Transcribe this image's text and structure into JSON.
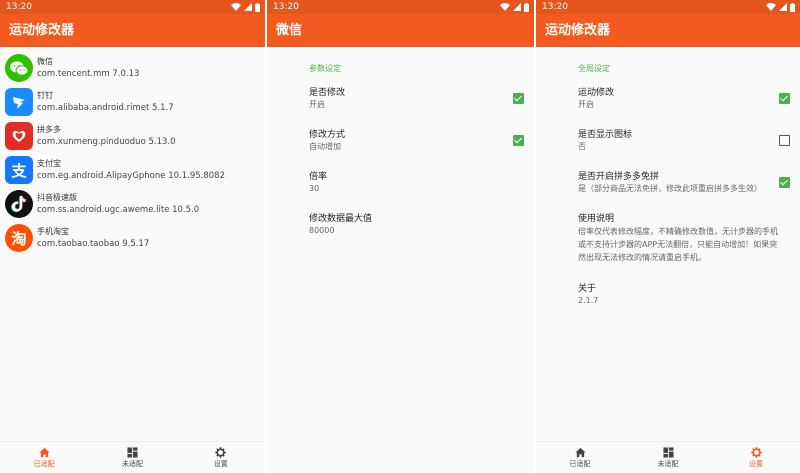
{
  "status": {
    "time": "13:20"
  },
  "colors": {
    "accent": "#f25a20",
    "status_bar": "#e4561e",
    "checkbox_on": "#4caf50"
  },
  "apps_screen": {
    "title": "运动修改器",
    "apps": [
      {
        "name": "微信",
        "package": "com.tencent.mm 7.0.13",
        "icon": "wechat-icon"
      },
      {
        "name": "钉钉",
        "package": "com.alibaba.android.rimet 5.1.7",
        "icon": "dingtalk-icon"
      },
      {
        "name": "拼多多",
        "package": "com.xunmeng.pinduoduo 5.13.0",
        "icon": "pinduoduo-icon"
      },
      {
        "name": "支付宝",
        "package": "com.eg.android.AlipayGphone 10.1.95.8082",
        "icon": "alipay-icon",
        "icon_char": "支"
      },
      {
        "name": "抖音极速版",
        "package": "com.ss.android.ugc.aweme.lite 10.5.0",
        "icon": "douyin-icon"
      },
      {
        "name": "手机淘宝",
        "package": "com.taobao.taobao 9.5.17",
        "icon": "taobao-icon",
        "icon_char": "淘"
      }
    ],
    "nav": [
      {
        "label": "已适配",
        "icon": "home-icon",
        "active": true
      },
      {
        "label": "未适配",
        "icon": "grid-icon",
        "active": false
      },
      {
        "label": "设置",
        "icon": "gear-icon",
        "active": false
      }
    ]
  },
  "wechat_screen": {
    "title": "微信",
    "section": "参数设定",
    "prefs": [
      {
        "title": "是否修改",
        "summary": "开启",
        "checked": true
      },
      {
        "title": "修改方式",
        "summary": "自动增加",
        "checked": true
      },
      {
        "title": "倍率",
        "summary": "30"
      },
      {
        "title": "修改数据最大值",
        "summary": "80000"
      }
    ]
  },
  "settings_screen": {
    "title": "运动修改器",
    "section": "全局设定",
    "prefs": [
      {
        "title": "运动修改",
        "summary": "开启",
        "checked": true
      },
      {
        "title": "是否显示图标",
        "summary": "否",
        "checked": false
      },
      {
        "title": "是否开启拼多多免拼",
        "summary": "是（部分商品无法免拼，修改此项重启拼多多生效）",
        "checked": true
      },
      {
        "title": "使用说明",
        "summary": "倍率仅代表修改幅度，不精确修改数值，无计步器的手机或不支持计步器的APP无法翻倍，只能自动增加！如果突然出现无法修改的情况请重启手机。"
      },
      {
        "title": "关于",
        "summary": "2.1.7"
      }
    ],
    "nav": [
      {
        "label": "已适配",
        "icon": "home-icon",
        "active": false
      },
      {
        "label": "未适配",
        "icon": "grid-icon",
        "active": false
      },
      {
        "label": "设置",
        "icon": "gear-icon",
        "active": true
      }
    ]
  }
}
